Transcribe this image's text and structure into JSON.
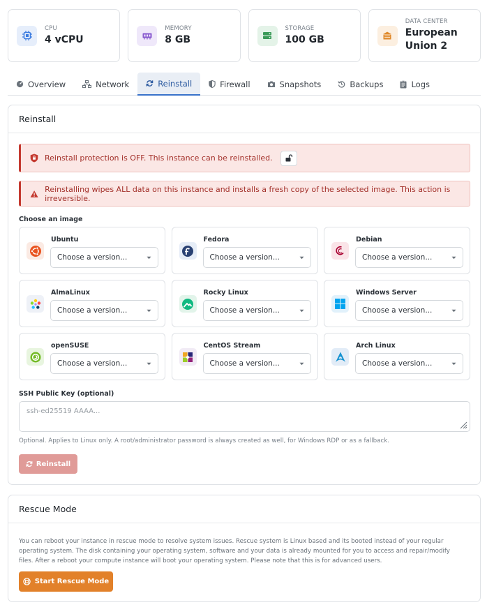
{
  "stats": [
    {
      "label": "CPU",
      "value": "4 vCPU",
      "icon": "cpu-icon",
      "color": "#3b7be0",
      "bg": "#e6eefb"
    },
    {
      "label": "MEMORY",
      "value": "8 GB",
      "icon": "memory-icon",
      "color": "#8a5bd0",
      "bg": "#efe8fa"
    },
    {
      "label": "STORAGE",
      "value": "100 GB",
      "icon": "storage-icon",
      "color": "#3a9a58",
      "bg": "#e4f3e8"
    },
    {
      "label": "DATA CENTER",
      "value": "European Union 2",
      "value_line1": "European",
      "value_line2": "Union 2",
      "icon": "datacenter-icon",
      "color": "#e08a2c",
      "bg": "#fcefe0"
    }
  ],
  "tabs": [
    {
      "label": "Overview",
      "icon": "gauge-icon"
    },
    {
      "label": "Network",
      "icon": "network-icon"
    },
    {
      "label": "Reinstall",
      "icon": "refresh-icon",
      "active": true
    },
    {
      "label": "Firewall",
      "icon": "shield-icon"
    },
    {
      "label": "Snapshots",
      "icon": "camera-icon"
    },
    {
      "label": "Backups",
      "icon": "history-icon"
    },
    {
      "label": "Logs",
      "icon": "clipboard-icon"
    }
  ],
  "reinstall": {
    "title": "Reinstall",
    "protection_alert": "Reinstall protection is OFF. This instance can be reinstalled.",
    "wipe_alert": "Reinstalling wipes ALL data on this instance and installs a fresh copy of the selected image. This action is irreversible.",
    "choose_label": "Choose an image",
    "images": [
      {
        "name": "Ubuntu",
        "placeholder": "Choose a version...",
        "icon": "ubuntu-icon"
      },
      {
        "name": "Fedora",
        "placeholder": "Choose a version...",
        "icon": "fedora-icon"
      },
      {
        "name": "Debian",
        "placeholder": "Choose a version...",
        "icon": "debian-icon"
      },
      {
        "name": "AlmaLinux",
        "placeholder": "Choose a version...",
        "icon": "almalinux-icon"
      },
      {
        "name": "Rocky Linux",
        "placeholder": "Choose a version...",
        "icon": "rocky-linux-icon"
      },
      {
        "name": "Windows Server",
        "placeholder": "Choose a version...",
        "icon": "windows-icon"
      },
      {
        "name": "openSUSE",
        "placeholder": "Choose a version...",
        "icon": "opensuse-icon"
      },
      {
        "name": "CentOS Stream",
        "placeholder": "Choose a version...",
        "icon": "centos-icon"
      },
      {
        "name": "Arch Linux",
        "placeholder": "Choose a version...",
        "icon": "arch-linux-icon"
      }
    ],
    "ssh_label": "SSH Public Key (optional)",
    "ssh_placeholder": "ssh-ed25519 AAAA...",
    "hint": "Optional. Applies to Linux only. A root/administrator password is always created as well, for Windows RDP or as a fallback.",
    "button": "Reinstall"
  },
  "rescue": {
    "title": "Rescue Mode",
    "description": "You can reboot your instance in rescue mode to resolve system issues. Rescue system is Linux based and its booted instead of your regular operating system. The disk containing your operating system, software and your data is already mounted for you to access and repair/modify files. After a reboot your compute instance will boot your operating system. Please note that this is for advanced users.",
    "button": "Start Rescue Mode"
  },
  "colors": {
    "accent": "#3872c9",
    "danger": "#c4392f",
    "danger_bg": "#fbe7e5",
    "reinstall_btn": "#e09b98",
    "rescue_btn": "#e2812a"
  }
}
